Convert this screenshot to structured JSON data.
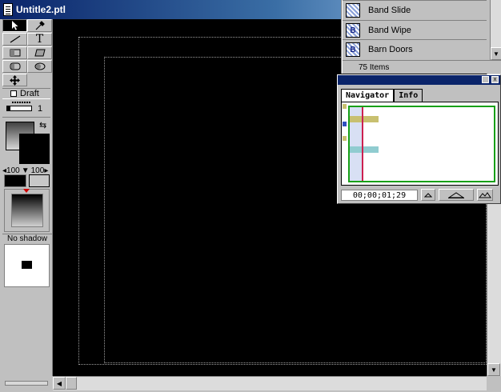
{
  "window": {
    "title": "Untitle2.ptl"
  },
  "toolbox": {
    "draft_label": "Draft",
    "line_width": "1",
    "opacity_value_1": "100",
    "opacity_value_2": "100",
    "shadow_label": "No shadow",
    "text_tool_glyph": "T"
  },
  "transitions": {
    "items": [
      {
        "label": "Band Slide",
        "icon": "band-slide-icon",
        "glyph": ""
      },
      {
        "label": "Band Wipe",
        "icon": "band-wipe-icon",
        "glyph": "B"
      },
      {
        "label": "Barn Doors",
        "icon": "barn-doors-icon",
        "glyph": "B"
      }
    ],
    "count": "75 Items"
  },
  "navigator": {
    "tabs": [
      {
        "label": "Navigator"
      },
      {
        "label": "Info"
      }
    ],
    "timecode": "00;00;01;29"
  },
  "colors": {
    "canvas": "#000000",
    "title_gradient_start": "#0a246a",
    "navigator_view_border": "#18a018",
    "playhead": "#cc2050",
    "clip_yellow": "#c8c070",
    "clip_teal": "#90ccd0"
  }
}
